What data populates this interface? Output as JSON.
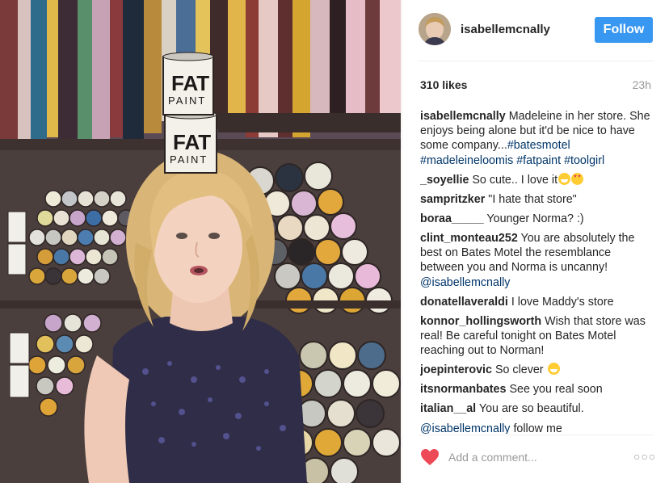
{
  "post": {
    "username": "isabellemcnally",
    "follow_label": "Follow",
    "likes": "310 likes",
    "time": "23h",
    "photo_can_text": [
      "FAT",
      "PAINT"
    ]
  },
  "comments": [
    {
      "user": "isabellemcnally",
      "text": "Madeleine in her store. She enjoys being alone but it'd be nice to have some company...",
      "tags": [
        "#batesmotel",
        "#madeleineloomis",
        "#fatpaint",
        "#toolgirl"
      ]
    },
    {
      "user": "_soyellie",
      "text": "So cute.. I love it",
      "emojis": [
        "grin",
        "heart-eyes"
      ]
    },
    {
      "user": "sampritzker",
      "text": "\"I hate that store\""
    },
    {
      "user": "boraa_____",
      "text": "Younger Norma? :)"
    },
    {
      "user": "clint_monteau252",
      "text": "You are absolutely the best on Bates Motel the resemblance between you and Norma is uncanny!",
      "mention": "@isabellemcnally"
    },
    {
      "user": "donatellaveraldi",
      "text": "I love Maddy's store"
    },
    {
      "user": "konnor_hollingsworth",
      "text": "Wish that store was real! Be careful tonight on Bates Motel reaching out to Norman!"
    },
    {
      "user": "joepinterovic",
      "text": "So clever",
      "emojis": [
        "smile"
      ]
    },
    {
      "user": "itsnormanbates",
      "text": "See you real soon"
    },
    {
      "user": "italian__al",
      "text": "You are so beautiful."
    },
    {
      "user": "",
      "mention": "@isabellemcnally",
      "text": "follow me"
    }
  ],
  "actions": {
    "comment_placeholder": "Add a comment...",
    "more_label": "○○○"
  },
  "icons": {
    "like": "heart-icon",
    "more": "more-options-icon"
  },
  "colors": {
    "follow_button": "#3897f0",
    "heart": "#ed4956",
    "hashtag": "#003569",
    "username": "#262626",
    "muted": "#999999"
  }
}
